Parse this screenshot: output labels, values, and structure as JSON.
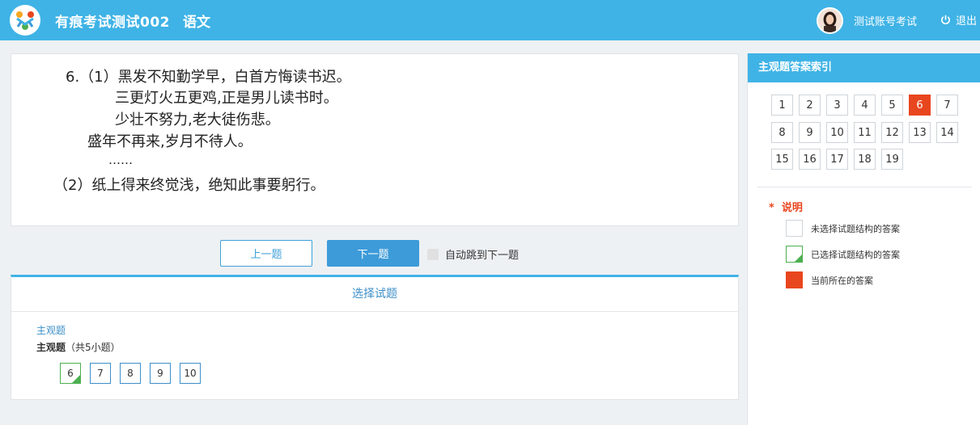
{
  "header": {
    "title": "有痕考试测试002",
    "subject": "语文",
    "user_name": "测试账号考试",
    "logout_label": "退出"
  },
  "question": {
    "lines": [
      "6.（1）黑发不知勤学早，白首方悔读书迟。",
      "三更灯火五更鸡,正是男儿读书时。",
      "少壮不努力,老大徒伤悲。",
      "盛年不再来,岁月不待人。",
      "……",
      "（2）纸上得来终觉浅，绝知此事要躬行。"
    ]
  },
  "nav": {
    "prev_label": "上一题",
    "next_label": "下一题",
    "auto_next_label": "自动跳到下一题"
  },
  "selector": {
    "title": "选择试题",
    "category_link": "主观题",
    "category_name": "主观题",
    "category_count": "（共5小题）",
    "questions": [
      "6",
      "7",
      "8",
      "9",
      "10"
    ]
  },
  "sidebar": {
    "title": "主观题答案索引",
    "numbers": [
      "1",
      "2",
      "3",
      "4",
      "5",
      "6",
      "7",
      "8",
      "9",
      "10",
      "11",
      "12",
      "13",
      "14",
      "15",
      "16",
      "17",
      "18",
      "19"
    ],
    "current": "6",
    "legend_title": "说明",
    "legend_star": "*",
    "legend": [
      "未选择试题结构的答案",
      "已选择试题结构的答案",
      "当前所在的答案"
    ]
  },
  "colors": {
    "header": "#3fb3e6",
    "accent": "#3d9bd9",
    "current": "#e8461e",
    "answered": "#4caf50"
  }
}
